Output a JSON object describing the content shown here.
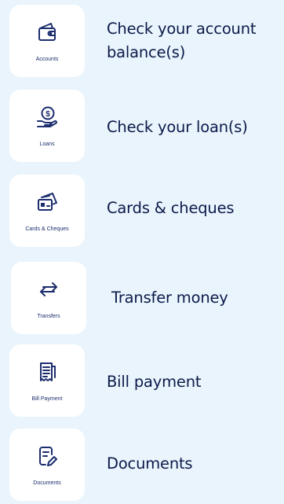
{
  "items": [
    {
      "icon": "wallet-icon",
      "label": "Accounts",
      "description": "Check your account balance(s)"
    },
    {
      "icon": "loan-money-hand-icon",
      "label": "Loans",
      "description": "Check your loan(s)"
    },
    {
      "icon": "cards-cheques-icon",
      "label": "Cards & Cheques",
      "description": "Cards & cheques"
    },
    {
      "icon": "transfer-arrows-icon",
      "label": "Transfers",
      "description": "Transfer money"
    },
    {
      "icon": "receipt-icon",
      "label": "Bill Payment",
      "description": "Bill payment"
    },
    {
      "icon": "document-edit-icon",
      "label": "Documents",
      "description": "Documents"
    }
  ],
  "colors": {
    "background": "#e9f4fc",
    "tile": "#ffffff",
    "icon": "#1c2e6e",
    "text": "#0c1a4a"
  }
}
